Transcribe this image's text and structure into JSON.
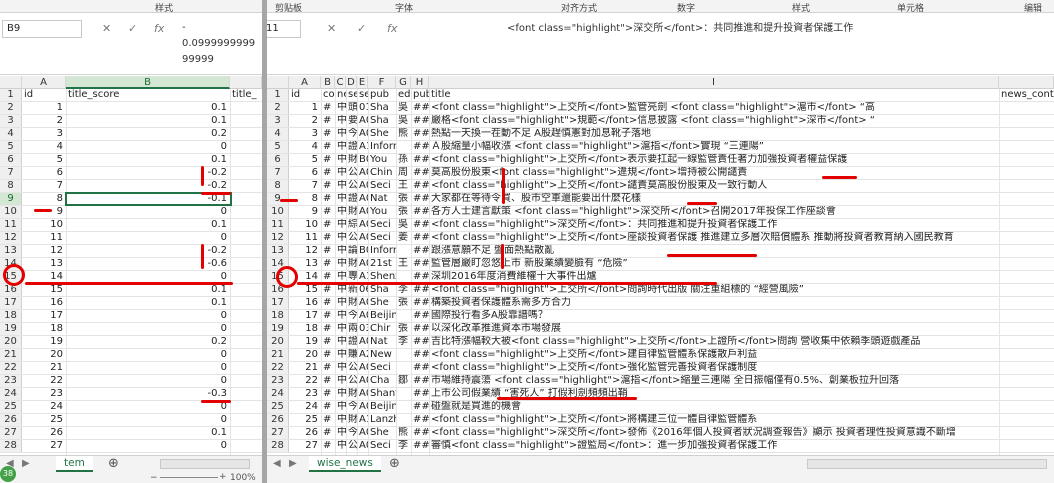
{
  "left": {
    "ribbon": {
      "styles": "样式"
    },
    "namebox": "B9",
    "formula_value": [
      "-",
      "0.0999999999",
      "99999"
    ],
    "columns": {
      "A": "A",
      "B": "B"
    },
    "rows": [
      {
        "n": "1",
        "a": "id",
        "b": "title_score",
        "c": "title_"
      },
      {
        "n": "2",
        "a": "1",
        "b": "0.1"
      },
      {
        "n": "3",
        "a": "2",
        "b": "0.1"
      },
      {
        "n": "4",
        "a": "3",
        "b": "0.2"
      },
      {
        "n": "5",
        "a": "4",
        "b": "0"
      },
      {
        "n": "6",
        "a": "5",
        "b": "0.1"
      },
      {
        "n": "7",
        "a": "6",
        "b": "-0.2"
      },
      {
        "n": "8",
        "a": "7",
        "b": "-0.2"
      },
      {
        "n": "9",
        "a": "8",
        "b": "-0.1"
      },
      {
        "n": "10",
        "a": "9",
        "b": "0"
      },
      {
        "n": "11",
        "a": "10",
        "b": "0.1"
      },
      {
        "n": "12",
        "a": "11",
        "b": "0"
      },
      {
        "n": "13",
        "a": "12",
        "b": "-0.2"
      },
      {
        "n": "14",
        "a": "13",
        "b": "-0.6"
      },
      {
        "n": "15",
        "a": "14",
        "b": "0"
      },
      {
        "n": "16",
        "a": "15",
        "b": "0.1"
      },
      {
        "n": "17",
        "a": "16",
        "b": "0.1"
      },
      {
        "n": "18",
        "a": "17",
        "b": "0"
      },
      {
        "n": "19",
        "a": "18",
        "b": "0"
      },
      {
        "n": "20",
        "a": "19",
        "b": "0.2"
      },
      {
        "n": "21",
        "a": "20",
        "b": "0"
      },
      {
        "n": "22",
        "a": "21",
        "b": "0"
      },
      {
        "n": "23",
        "a": "22",
        "b": "0"
      },
      {
        "n": "24",
        "a": "23",
        "b": "-0.3"
      },
      {
        "n": "25",
        "a": "24",
        "b": "0"
      },
      {
        "n": "26",
        "a": "25",
        "b": "0"
      },
      {
        "n": "27",
        "a": "26",
        "b": "0.1"
      },
      {
        "n": "28",
        "a": "27",
        "b": "0"
      }
    ],
    "sheet_tab": "tem",
    "zoom": "100%",
    "status": "38"
  },
  "right": {
    "ribbon": {
      "clipboard": "剪贴板",
      "font": "字体",
      "align": "对齐方式",
      "number": "数字",
      "styles": "样式",
      "cells": "单元格",
      "edit": "编辑"
    },
    "namebox": "11",
    "formula_value": "<font class=\"highlight\">深交所</font>：共同推進和提升投資者保護工作",
    "columns": [
      "A",
      "B",
      "C",
      "D",
      "E",
      "F",
      "G",
      "H",
      "I"
    ],
    "header_row": {
      "n": "1",
      "a": "id",
      "b": "co",
      "c": "ne",
      "d": "sec",
      "e": "se",
      "f": "pub",
      "g": "edi",
      "h": "pub",
      "i": "title",
      "j": "news_conten"
    },
    "rows": [
      {
        "n": "2",
        "a": "1",
        "c": "#",
        "d": "中",
        "e": "頭版",
        "f": "01",
        "g": "Sha",
        "h": "吳",
        "i2": "##",
        "t": "<font class=\"highlight\">上交所</font>監管亮劍 <font class=\"highlight\">滬市</font> “高"
      },
      {
        "n": "3",
        "a": "2",
        "c": "#",
        "d": "中",
        "e": "要聞",
        "f": "A0",
        "g": "Sha",
        "h": "吳",
        "i2": "##",
        "t": "嚴格<font class=\"highlight\">規範</font>信息披露 <font class=\"highlight\">深市</font> “"
      },
      {
        "n": "4",
        "a": "3",
        "c": "#",
        "d": "中",
        "e": "今日",
        "f": "A0",
        "g": "She",
        "h": "熊",
        "i2": "##",
        "t": "熱點一天換一茬動不足 A股趕慎憲對加息靴子落地"
      },
      {
        "n": "5",
        "a": "4",
        "c": "#",
        "d": "中",
        "e": "證券",
        "f": "A1",
        "g": "Informa",
        "h": "",
        "i2": "##",
        "t": "Ａ股縮量小幅收漲 <font class=\"highlight\">滬指</font>實現 “三連陽”"
      },
      {
        "n": "6",
        "a": "5",
        "c": "#",
        "d": "中",
        "e": "財經",
        "f": "B0",
        "g": "You",
        "h": "孫",
        "i2": "##",
        "t": "<font class=\"highlight\">上交所</font>表示要扛起一線監管責任著力加強投資者權益保護"
      },
      {
        "n": "7",
        "a": "6",
        "c": "#",
        "d": "中",
        "e": "公司",
        "f": "A0",
        "g": "Chin",
        "h": "周",
        "i2": "##",
        "t": "莫高股份股東<font class=\"highlight\">違規</font>增持被公開譴責"
      },
      {
        "n": "8",
        "a": "7",
        "c": "#",
        "d": "中",
        "e": "公司",
        "f": "A0",
        "g": "Seci",
        "h": "王",
        "i2": "##",
        "t": "<font class=\"highlight\">上交所</font>譴責莫高股份股東及一致行動人"
      },
      {
        "n": "9",
        "a": "8",
        "c": "#",
        "d": "中",
        "e": "證券",
        "f": "A0",
        "g": "Nat",
        "h": "張",
        "i2": "##",
        "t": "大家都在等待令買、股市空軍還能要出什麼花樣"
      },
      {
        "n": "10",
        "a": "9",
        "c": "#",
        "d": "中",
        "e": "財經",
        "f": "A0",
        "g": "You",
        "h": "張",
        "i2": "##",
        "t": "各方人士建言獻策 <font class=\"highlight\">深交所</font>召開2017年投保工作座談會"
      },
      {
        "n": "11",
        "a": "10",
        "c": "#",
        "d": "中",
        "e": "綜合",
        "f": "A0",
        "g": "Seci",
        "h": "吳",
        "i2": "##",
        "t": "<font class=\"highlight\">深交所</font>：共同推進和提升投資者保護工作"
      },
      {
        "n": "12",
        "a": "11",
        "c": "#",
        "d": "中",
        "e": "公司",
        "f": "A0",
        "g": "Seci",
        "h": "姜",
        "i2": "##",
        "t": "<font class=\"highlight\">上交所</font>座談投資者保護 推進建立多層次賠償體系 推動將投資者教育納入國民教育"
      },
      {
        "n": "13",
        "a": "12",
        "c": "#",
        "d": "中",
        "e": "論壇",
        "f": "B0",
        "g": "Informa",
        "h": "",
        "i2": "##",
        "t": "跟漲意願不足 盤面熱點散亂"
      },
      {
        "n": "14",
        "a": "13",
        "c": "#",
        "d": "中",
        "e": "財經",
        "f": "A0",
        "g": "21st",
        "h": "王",
        "i2": "##",
        "t": "監管層嚴盯忽悠上市 新股業績變臉有 “危險”"
      },
      {
        "n": "15",
        "a": "14",
        "c": "#",
        "d": "中",
        "e": "專題",
        "f": "A1",
        "g": "Shenzh",
        "h": "",
        "i2": "##",
        "t": "深圳2016年度消費維權十大事件出爐"
      },
      {
        "n": "16",
        "a": "15",
        "c": "#",
        "d": "中",
        "e": "新聞",
        "f": "06",
        "g": "Sha",
        "h": "李",
        "i2": "##",
        "t": "<font class=\"highlight\">上交所</font>問詢時代出版 關注重組標的 “經營風險”"
      },
      {
        "n": "17",
        "a": "16",
        "c": "#",
        "d": "中",
        "e": "財經",
        "f": "A0",
        "g": "She",
        "h": "張",
        "i2": "##",
        "t": "構築投資者保護體系需多方合力"
      },
      {
        "n": "18",
        "a": "17",
        "c": "#",
        "d": "中",
        "e": "今日",
        "f": "A0",
        "g": "Beijing",
        "h": "",
        "i2": "##",
        "t": "國際投行看多A股靠譜嗎？"
      },
      {
        "n": "19",
        "a": "18",
        "c": "#",
        "d": "中",
        "e": "兩會",
        "f": "03",
        "g": "Chir",
        "h": "張",
        "i2": "##",
        "t": "以深化改革推進資本市場發展"
      },
      {
        "n": "20",
        "a": "19",
        "c": "#",
        "d": "中",
        "e": "證券",
        "f": "A0",
        "g": "Nat",
        "h": "李",
        "i2": "##",
        "t": "吉比特漲幅較大被<font class=\"highlight\">上交所</font>上證所</font>問詢 營收集中依賴季頭遊戲產品"
      },
      {
        "n": "21",
        "a": "20",
        "c": "#",
        "d": "中",
        "e": "賺錢",
        "f": "A2",
        "g": "New Ex",
        "h": "",
        "i2": "##",
        "t": "<font class=\"highlight\">上交所</font>建自律監管體系保護散戶利益"
      },
      {
        "n": "22",
        "a": "21",
        "c": "#",
        "d": "中",
        "e": "公司",
        "f": "A0",
        "g": "Seci",
        "h": "",
        "i2": "##",
        "t": "<font class=\"highlight\">上交所</font>強化監管完善投資者保護制度"
      },
      {
        "n": "23",
        "a": "22",
        "c": "#",
        "d": "中",
        "e": "公司",
        "f": "A0",
        "g": "Cha",
        "h": "鄒",
        "i2": "##",
        "t": "市場維持震蕩 <font class=\"highlight\">滬指</font>縮量三連陽 全日振幅僅有0.5%、創業板拉升回落"
      },
      {
        "n": "24",
        "a": "23",
        "c": "#",
        "d": "中",
        "e": "財經",
        "f": "A0",
        "g": "Shanto",
        "h": "",
        "i2": "##",
        "t": "上市公司假業績 “害死人” 打假利劍頻頻出鞘"
      },
      {
        "n": "25",
        "a": "24",
        "c": "#",
        "d": "中",
        "e": "今日",
        "f": "A0",
        "g": "Beijing",
        "h": "",
        "i2": "##",
        "t": "碰盤就是買進的機會"
      },
      {
        "n": "26",
        "a": "25",
        "c": "#",
        "d": "中",
        "e": "財經",
        "f": "A1",
        "g": "Lanzho",
        "h": "",
        "i2": "##",
        "t": "<font class=\"highlight\">上交所</font>將構建三位一體自律監管體系"
      },
      {
        "n": "27",
        "a": "26",
        "c": "#",
        "d": "中",
        "e": "今日",
        "f": "A0",
        "g": "She",
        "h": "熊",
        "i2": "##",
        "t": "<font class=\"highlight\">深交所</font>發佈《2016年個人投資者狀況調查報告》顯示 投資者理性投資意識不斷增"
      },
      {
        "n": "28",
        "a": "27",
        "c": "#",
        "d": "中",
        "e": "公司",
        "f": "A0",
        "g": "Seci",
        "h": "李",
        "i2": "##",
        "t": "審慎<font class=\"highlight\">證監局</font>：進一步加強投資者保護工作"
      }
    ],
    "sheet_tab": "wise_news"
  }
}
